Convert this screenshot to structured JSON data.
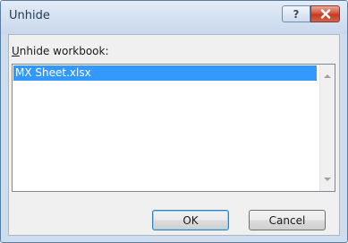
{
  "dialog": {
    "title": "Unhide",
    "help_glyph": "?",
    "help_icon": "help-icon",
    "close_icon": "close-icon",
    "label": "Unhide workbook:",
    "label_accesskey": "U",
    "workbooks": [
      "MX Sheet.xlsx"
    ],
    "selected_index": 0,
    "ok_label": "OK",
    "cancel_label": "Cancel"
  },
  "colors": {
    "title_text": "#1e395b",
    "selection": "#3399ff",
    "close_button": "#c23a21",
    "client_bg": "#f0f0f0"
  }
}
